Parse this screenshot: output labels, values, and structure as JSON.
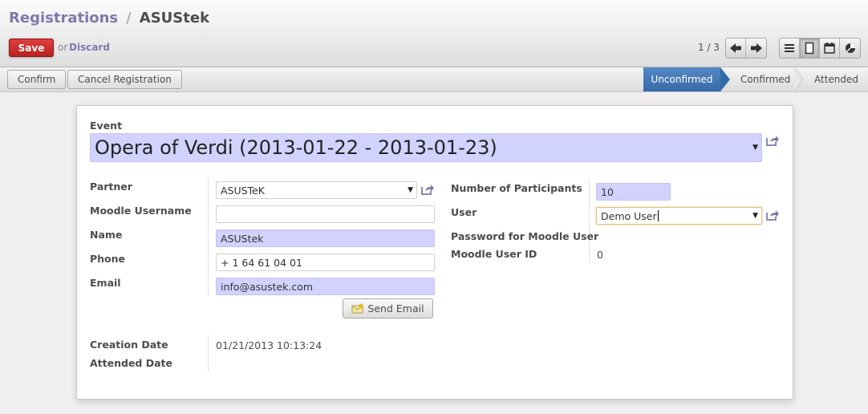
{
  "breadcrumb": {
    "parent": "Registrations",
    "separator": "/",
    "current": "ASUStek"
  },
  "toolbar": {
    "save_label": "Save",
    "or_label": "or",
    "discard_label": "Discard"
  },
  "pager": {
    "value": "1 / 3",
    "prev_icon": "arrow-left-icon",
    "next_icon": "arrow-right-icon"
  },
  "views": {
    "icons": [
      "list-view-icon",
      "form-view-icon",
      "calendar-view-icon",
      "graph-view-icon"
    ],
    "active": "form-view-icon"
  },
  "actions": {
    "confirm_label": "Confirm",
    "cancel_label": "Cancel Registration"
  },
  "stages": {
    "items": [
      "Unconfirmed",
      "Confirmed",
      "Attended"
    ],
    "active": "Unconfirmed",
    "active_color": "#3f6fb3"
  },
  "form": {
    "event_label": "Event",
    "event_value": "Opera of Verdi (2013-01-22 - 2013-01-23)",
    "partner_label": "Partner",
    "partner_value": "ASUSTeK",
    "moodle_username_label": "Moodle Username",
    "moodle_username_value": "",
    "name_label": "Name",
    "name_value": "ASUStek",
    "phone_label": "Phone",
    "phone_value": "+ 1 64 61 04 01",
    "email_label": "Email",
    "email_value": "info@asustek.com",
    "send_email_label": "Send Email",
    "participants_label": "Number of Participants",
    "participants_value": "10",
    "user_label": "User",
    "user_value": "Demo User",
    "moodle_password_label": "Password for Moodle User",
    "moodle_user_id_label": "Moodle User ID",
    "moodle_user_id_value": "0",
    "creation_date_label": "Creation Date",
    "creation_date_value": "01/21/2013 10:13:24",
    "attended_date_label": "Attended Date",
    "attended_date_value": ""
  },
  "colors": {
    "required_field": "#d2d2ff",
    "save_button": "#c92c2c",
    "link": "#7c7bad"
  }
}
